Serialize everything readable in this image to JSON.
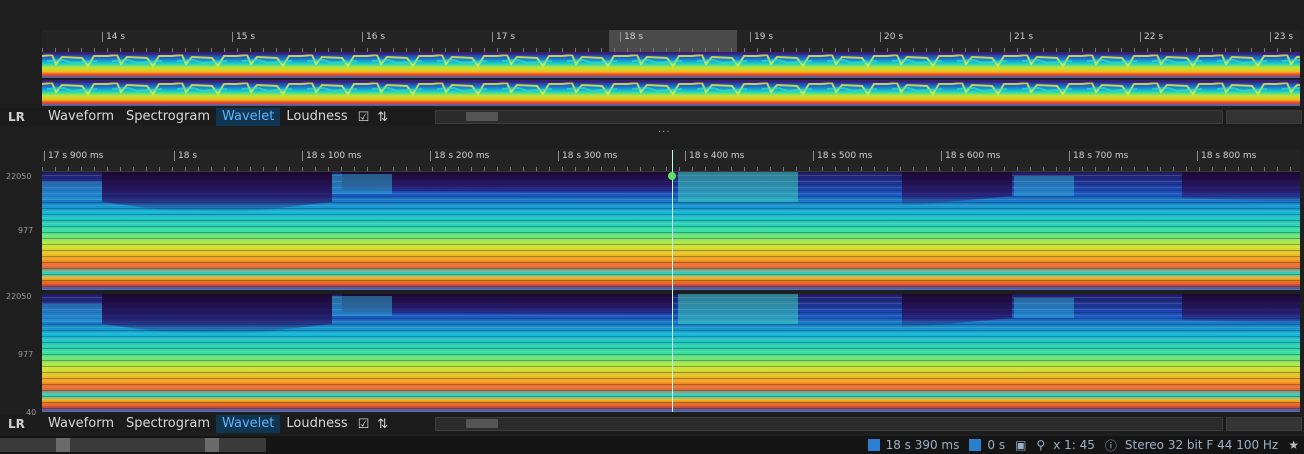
{
  "overview": {
    "ruler_ticks": [
      "14 s",
      "15 s",
      "16 s",
      "17 s",
      "18 s",
      "19 s",
      "20 s",
      "21 s",
      "22 s",
      "23 s"
    ]
  },
  "detail": {
    "ruler_ticks": [
      "17 s 900 ms",
      "18 s",
      "18 s 100 ms",
      "18 s 200 ms",
      "18 s 300 ms",
      "18 s 400 ms",
      "18 s 500 ms",
      "18 s 600 ms",
      "18 s 700 ms",
      "18 s 800 ms"
    ],
    "axis": {
      "top_ch1": "22050",
      "mid_ch1": "977",
      "top_ch2": "22050",
      "mid_ch2": "977",
      "bottom_ch2": "40"
    }
  },
  "tabs": {
    "channel_label": "LR",
    "items": [
      "Waveform",
      "Spectrogram",
      "Wavelet",
      "Loudness"
    ],
    "active": "Wavelet"
  },
  "divider_label": "...",
  "status": {
    "cursor_pos": "18 s 390 ms",
    "selection_len": "0 s",
    "zoom": "x 1: 45",
    "format": "Stereo 32 bit F 44 100 Hz"
  },
  "colors": {
    "active_tab_text": "#5fb3ff",
    "active_tab_bg": "#0f3550",
    "status_text": "#9ab0c8"
  }
}
